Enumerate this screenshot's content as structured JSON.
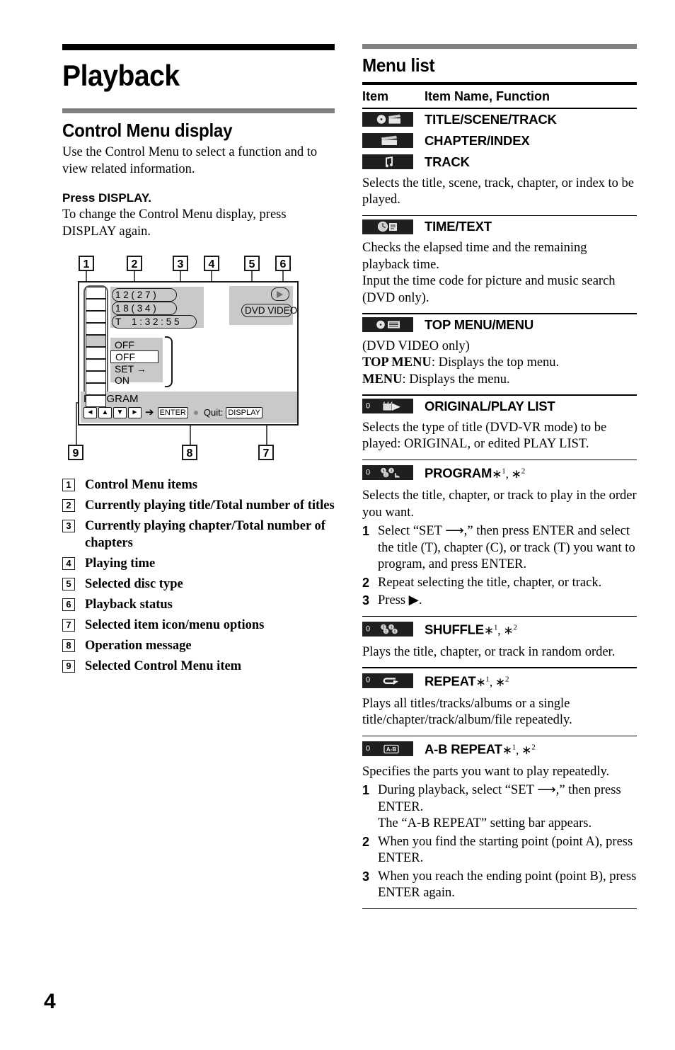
{
  "document": {
    "page_number": "4"
  },
  "left": {
    "title": "Playback",
    "section_title": "Control Menu display",
    "intro": "Use the Control Menu to select a function and to view related information.",
    "press_display_heading": "Press DISPLAY.",
    "press_display_body": "To change the Control Menu display, press DISPLAY again.",
    "figure": {
      "callouts": [
        "1",
        "2",
        "3",
        "4",
        "5",
        "6",
        "7",
        "8",
        "9"
      ],
      "title_line": "1 2 ( 2 7 )",
      "chapter_line": "1 8 ( 3 4 )",
      "time_line": "T    1 : 3 2 : 5 5",
      "disc_type": "DVD VIDEO",
      "playback_status_icon": "play-icon",
      "options": [
        "OFF",
        "OFF",
        "SET →",
        "ON"
      ],
      "selected_option": "OFF",
      "program_label": "PROGRAM",
      "hint_keys": [
        "◄",
        "▲",
        "▼",
        "►"
      ],
      "hint_arrow": "➔",
      "hint_enter": "ENTER",
      "hint_quit_label": "Quit:",
      "hint_quit_key": "DISPLAY"
    },
    "legend": [
      {
        "num": "1",
        "text": "Control Menu items"
      },
      {
        "num": "2",
        "text": "Currently playing title/Total number of titles"
      },
      {
        "num": "3",
        "text": "Currently playing chapter/Total number of chapters"
      },
      {
        "num": "4",
        "text": "Playing time"
      },
      {
        "num": "5",
        "text": "Selected disc type"
      },
      {
        "num": "6",
        "text": "Playback status"
      },
      {
        "num": "7",
        "text": "Selected item icon/menu options"
      },
      {
        "num": "8",
        "text": "Operation message"
      },
      {
        "num": "9",
        "text": "Selected Control Menu item"
      }
    ]
  },
  "right": {
    "title": "Menu list",
    "table_header": {
      "item": "Item",
      "item_name_function": "Item Name, Function"
    },
    "entries": [
      {
        "icons": [
          {
            "glyph": "disc-clapper-icon",
            "zero": false
          },
          {
            "glyph": "clapper-icon",
            "zero": false
          },
          {
            "glyph": "music-note-icon",
            "zero": false
          }
        ],
        "names": [
          "TITLE/SCENE/TRACK",
          "CHAPTER/INDEX",
          "TRACK"
        ],
        "footnotes": "",
        "description": "Selects the title, scene, track, chapter, or index to be played."
      },
      {
        "icons": [
          {
            "glyph": "clock-text-icon",
            "zero": false
          }
        ],
        "names": [
          "TIME/TEXT"
        ],
        "footnotes": "",
        "description": "Checks the elapsed time and the remaining playback time.\nInput the time code for picture and music search (DVD only)."
      },
      {
        "icons": [
          {
            "glyph": "disc-list-icon",
            "zero": false
          }
        ],
        "names": [
          "TOP MENU/MENU"
        ],
        "footnotes": "",
        "description_rich": [
          {
            "text": "(DVD VIDEO only)",
            "bold": false
          },
          {
            "text": "TOP MENU",
            "bold": true
          },
          {
            "text": ": Displays the top menu.",
            "bold": false
          },
          {
            "text": "MENU",
            "bold": true
          },
          {
            "text": ": Displays the menu.",
            "bold": false
          }
        ]
      },
      {
        "icons": [
          {
            "glyph": "original-playlist-icon",
            "zero": true
          }
        ],
        "names": [
          "ORIGINAL/PLAY LIST"
        ],
        "footnotes": "",
        "description": "Selects the type of title (DVD-VR mode) to be played: ORIGINAL, or edited PLAY LIST."
      },
      {
        "icons": [
          {
            "glyph": "program-icon",
            "zero": true
          }
        ],
        "names": [
          "PROGRAM"
        ],
        "footnotes": "*1, *2",
        "description": "Selects the title, chapter, or track to play in the order you want.",
        "steps": [
          {
            "n": "1",
            "text": "Select “SET ⟶,” then press ENTER and select the title (T), chapter (C), or track (T) you want to program, and press ENTER."
          },
          {
            "n": "2",
            "text": "Repeat selecting the title, chapter, or track."
          },
          {
            "n": "3",
            "text": "Press ▶."
          }
        ]
      },
      {
        "icons": [
          {
            "glyph": "shuffle-icon",
            "zero": true
          }
        ],
        "names": [
          "SHUFFLE"
        ],
        "footnotes": "*1, *2",
        "description": "Plays the title, chapter, or track in random order."
      },
      {
        "icons": [
          {
            "glyph": "repeat-icon",
            "zero": true
          }
        ],
        "names": [
          "REPEAT"
        ],
        "footnotes": "*1, *2",
        "description": "Plays all titles/tracks/albums or a single title/chapter/track/album/file repeatedly."
      },
      {
        "icons": [
          {
            "glyph": "ab-repeat-icon",
            "zero": true
          }
        ],
        "names": [
          "A-B REPEAT"
        ],
        "footnotes": "*1, *2",
        "description": "Specifies the parts you want to play repeatedly.",
        "steps": [
          {
            "n": "1",
            "text": "During playback, select “SET ⟶,” then press ENTER.\nThe “A-B REPEAT” setting bar appears."
          },
          {
            "n": "2",
            "text": "When you find the starting point (point A), press ENTER."
          },
          {
            "n": "3",
            "text": "When you reach the ending point (point B), press ENTER again."
          }
        ]
      }
    ]
  },
  "colors": {
    "rule_black": "#000000",
    "rule_gray": "#808080",
    "icon_chip_bg": "#1f1f1f",
    "screen_gray": "#c9c9c9"
  }
}
